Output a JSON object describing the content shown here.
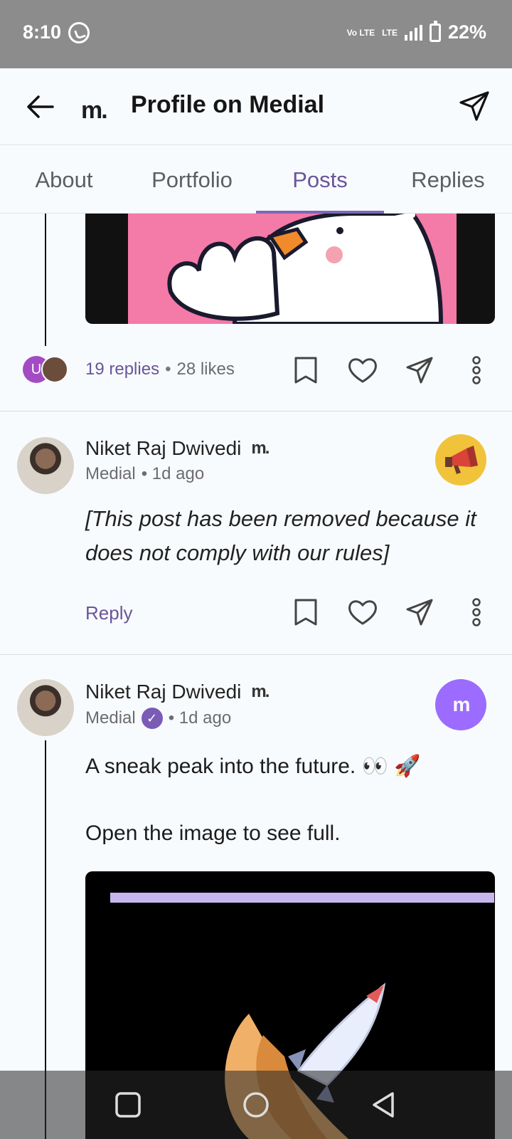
{
  "status_bar": {
    "time": "8:10",
    "network": "Vo LTE",
    "lte": "LTE",
    "battery": "22%"
  },
  "app_bar": {
    "logo_text": "m.",
    "title": "Profile on Medial"
  },
  "tabs": [
    {
      "label": "About",
      "active": false
    },
    {
      "label": "Portfolio",
      "active": false
    },
    {
      "label": "Posts",
      "active": true
    },
    {
      "label": "Replies",
      "active": false
    }
  ],
  "post1": {
    "avatar_letter": "U",
    "replies": "19 replies",
    "likes": "28 likes"
  },
  "post2": {
    "author": "Niket Raj Dwivedi",
    "logo_text": "m.",
    "source": "Medial",
    "time": "• 1d ago",
    "text": "[This post has been removed because it does not comply with our rules]",
    "reply_label": "Reply",
    "badge_icon": "megaphone-icon"
  },
  "post3": {
    "author": "Niket Raj Dwivedi",
    "logo_text": "m.",
    "source": "Medial",
    "time": "• 1d ago",
    "line1": "A sneak peak into the future. 👀 🚀",
    "line2": "Open the image to see full.",
    "badge_text": "m"
  },
  "colors": {
    "accent": "#6a5599",
    "pink": "#f47aa8",
    "badge_yellow": "#f0c33a",
    "badge_purple": "#9b6cff"
  }
}
